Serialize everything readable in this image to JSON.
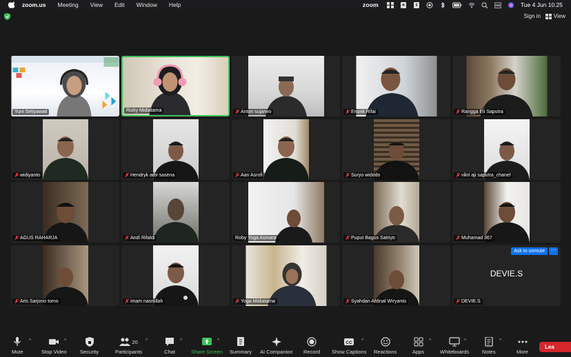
{
  "menubar": {
    "app": "zoom.us",
    "items": [
      "Meeting",
      "View",
      "Edit",
      "Window",
      "Help"
    ],
    "zoom_label": "zoom",
    "datetime": "Tue 4 Jun  10.25"
  },
  "header": {
    "sign_in": "Sign in",
    "view": "View"
  },
  "participants": [
    {
      "name": "Yuni Setiyawati",
      "muted": false
    },
    {
      "name": "Rizky Midiatama",
      "muted": false
    },
    {
      "name": "Anton sujarwo",
      "muted": true
    },
    {
      "name": "Enunk Rifai",
      "muted": true
    },
    {
      "name": "Rangga Eli Saputra",
      "muted": true
    },
    {
      "name": "widiyanto",
      "muted": true
    },
    {
      "name": "Hendryk arbi sasena",
      "muted": true
    },
    {
      "name": "Aan Asrofi",
      "muted": true
    },
    {
      "name": "Suryo widodo",
      "muted": true
    },
    {
      "name": "vikri aji saputra_chanel",
      "muted": true
    },
    {
      "name": "AGUS RAHARJA",
      "muted": true
    },
    {
      "name": "Andi Rifaldi",
      "muted": true
    },
    {
      "name": "Roby Yoga Asmara",
      "muted": true
    },
    {
      "name": "Puput Bagus Satriyo",
      "muted": true
    },
    {
      "name": "Muhamad 367",
      "muted": true
    },
    {
      "name": "Aris Sarjono tomo",
      "muted": true
    },
    {
      "name": "imam nasrullah",
      "muted": true
    },
    {
      "name": "Yoga Midiatama",
      "muted": true
    },
    {
      "name": "Syahdan Afdinal Wiryanto",
      "muted": true
    },
    {
      "name": "DEVIE.S",
      "muted": true
    }
  ],
  "camera_off_tile": {
    "display_name": "DEVIE.S",
    "ask_to_unmute": "Ask to unmute",
    "more": "···"
  },
  "toolbar": {
    "mute": "Mute",
    "stop_video": "Stop Video",
    "security": "Security",
    "participants": "Participants",
    "participants_count": "20",
    "chat": "Chat",
    "share_screen": "Share Screen",
    "summary": "Summary",
    "ai_companion": "AI Companion",
    "record": "Record",
    "show_captions": "Show Captions",
    "reactions": "Reactions",
    "apps": "Apps",
    "whiteboards": "Whiteboards",
    "notes": "Notes",
    "more": "More",
    "leave": "Lea"
  },
  "colors": {
    "active_speaker": "#3ec25b",
    "ask_to_unmute": "#0e72ed",
    "leave": "#d5262b",
    "muted_mic": "#e0383e"
  }
}
